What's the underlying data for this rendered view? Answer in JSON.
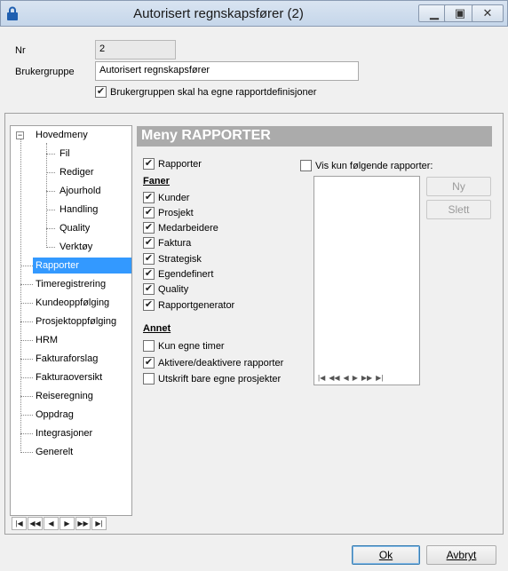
{
  "window": {
    "title": "Autorisert regnskapsfører (2)"
  },
  "form": {
    "nr_label": "Nr",
    "nr_value": "2",
    "group_label": "Brukergruppe",
    "group_value": "Autorisert regnskapsfører",
    "own_reports_label": "Brukergruppen skal ha egne rapportdefinisjoner",
    "own_reports_checked": true
  },
  "tree": {
    "root": "Hovedmeny",
    "children": [
      "Fil",
      "Rediger",
      "Ajourhold",
      "Handling",
      "Quality",
      "Verktøy"
    ],
    "items": [
      "Rapporter",
      "Timeregistrering",
      "Kundeoppfølging",
      "Prosjektoppfølging",
      "HRM",
      "Fakturaforslag",
      "Fakturaoversikt",
      "Reiseregning",
      "Oppdrag",
      "Integrasjoner",
      "Generelt"
    ],
    "selected": "Rapporter"
  },
  "menu": {
    "header": "Meny RAPPORTER",
    "rapporter_label": "Rapporter",
    "faner_title": "Faner",
    "faner": [
      {
        "label": "Kunder",
        "checked": true
      },
      {
        "label": "Prosjekt",
        "checked": true
      },
      {
        "label": "Medarbeidere",
        "checked": true
      },
      {
        "label": "Faktura",
        "checked": true
      },
      {
        "label": "Strategisk",
        "checked": true
      },
      {
        "label": "Egendefinert",
        "checked": true
      },
      {
        "label": "Quality",
        "checked": true
      },
      {
        "label": "Rapportgenerator",
        "checked": true
      }
    ],
    "annet_title": "Annet",
    "annet": [
      {
        "label": "Kun egne timer",
        "checked": false
      },
      {
        "label": "Aktivere/deaktivere rapporter",
        "checked": true
      },
      {
        "label": "Utskrift bare egne prosjekter",
        "checked": false
      }
    ],
    "vis_kun_label": "Vis kun følgende rapporter:",
    "ny_label": "Ny",
    "slett_label": "Slett"
  },
  "footer": {
    "ok_label": "Ok",
    "cancel_label": "Avbryt"
  }
}
